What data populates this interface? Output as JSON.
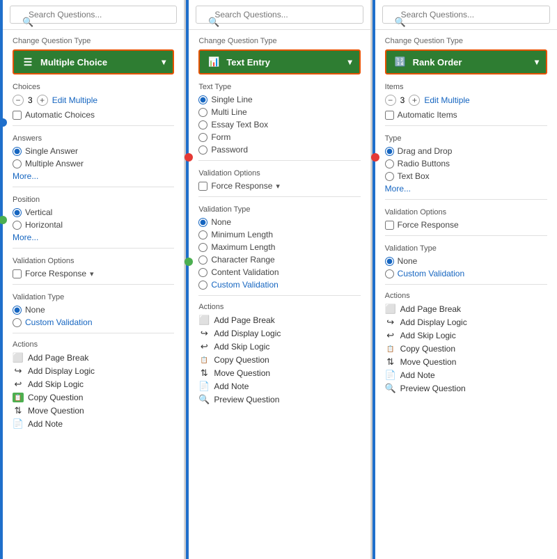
{
  "panels": [
    {
      "id": "multiple-choice",
      "search": {
        "placeholder": "Search Questions...",
        "value": ""
      },
      "changeQuestionTypeLabel": "Change Question Type",
      "questionType": {
        "label": "Multiple Choice",
        "icon": "list-icon"
      },
      "choices": {
        "label": "Choices",
        "count": "3",
        "editMultipleLabel": "Edit Multiple",
        "automaticChoicesLabel": "Automatic Choices"
      },
      "answers": {
        "label": "Answers",
        "options": [
          "Single Answer",
          "Multiple Answer"
        ],
        "selected": 0,
        "moreLabel": "More..."
      },
      "position": {
        "label": "Position",
        "options": [
          "Vertical",
          "Horizontal"
        ],
        "selected": 0,
        "moreLabel": "More..."
      },
      "validationOptions": {
        "label": "Validation Options",
        "forceResponseLabel": "Force Response"
      },
      "validationType": {
        "label": "Validation Type",
        "options": [
          "None",
          "Custom Validation"
        ],
        "selected": 0
      },
      "actions": {
        "label": "Actions",
        "items": [
          {
            "label": "Add Page Break",
            "icon": "page-break-icon"
          },
          {
            "label": "Add Display Logic",
            "icon": "display-logic-icon"
          },
          {
            "label": "Add Skip Logic",
            "icon": "skip-logic-icon"
          },
          {
            "label": "Copy Question",
            "icon": "copy-question-icon"
          },
          {
            "label": "Move Question",
            "icon": "move-question-icon"
          },
          {
            "label": "Add Note",
            "icon": "add-note-icon"
          }
        ]
      }
    },
    {
      "id": "text-entry",
      "search": {
        "placeholder": "Search Questions...",
        "value": ""
      },
      "changeQuestionTypeLabel": "Change Question Type",
      "questionType": {
        "label": "Text Entry",
        "icon": "text-entry-icon"
      },
      "textType": {
        "label": "Text Type",
        "options": [
          "Single Line",
          "Multi Line",
          "Essay Text Box",
          "Form",
          "Password"
        ],
        "selected": 0
      },
      "validationOptions": {
        "label": "Validation Options",
        "forceResponseLabel": "Force Response"
      },
      "validationType": {
        "label": "Validation Type",
        "options": [
          "None",
          "Minimum Length",
          "Maximum Length",
          "Character Range",
          "Content Validation",
          "Custom Validation"
        ],
        "selected": 0
      },
      "actions": {
        "label": "Actions",
        "items": [
          {
            "label": "Add Page Break",
            "icon": "page-break-icon"
          },
          {
            "label": "Add Display Logic",
            "icon": "display-logic-icon"
          },
          {
            "label": "Add Skip Logic",
            "icon": "skip-logic-icon"
          },
          {
            "label": "Copy Question",
            "icon": "copy-question-icon"
          },
          {
            "label": "Move Question",
            "icon": "move-question-icon"
          },
          {
            "label": "Add Note",
            "icon": "add-note-icon"
          },
          {
            "label": "Preview Question",
            "icon": "preview-icon"
          }
        ]
      }
    },
    {
      "id": "rank-order",
      "search": {
        "placeholder": "Search Questions...",
        "value": ""
      },
      "changeQuestionTypeLabel": "Change Question Type",
      "questionType": {
        "label": "Rank Order",
        "icon": "rank-order-icon"
      },
      "items": {
        "label": "Items",
        "count": "3",
        "editMultipleLabel": "Edit Multiple",
        "automaticItemsLabel": "Automatic Items"
      },
      "type": {
        "label": "Type",
        "options": [
          "Drag and Drop",
          "Radio Buttons",
          "Text Box"
        ],
        "selected": 0,
        "moreLabel": "More..."
      },
      "validationOptions": {
        "label": "Validation Options",
        "forceResponseLabel": "Force Response"
      },
      "validationType": {
        "label": "Validation Type",
        "options": [
          "None",
          "Custom Validation"
        ],
        "selected": 0
      },
      "actions": {
        "label": "Actions",
        "items": [
          {
            "label": "Add Page Break",
            "icon": "page-break-icon"
          },
          {
            "label": "Add Display Logic",
            "icon": "display-logic-icon"
          },
          {
            "label": "Add Skip Logic",
            "icon": "skip-logic-icon"
          },
          {
            "label": "Copy Question",
            "icon": "copy-question-icon"
          },
          {
            "label": "Move Question",
            "icon": "move-question-icon"
          },
          {
            "label": "Add Note",
            "icon": "add-note-icon"
          },
          {
            "label": "Preview Question",
            "icon": "preview-icon"
          }
        ]
      }
    }
  ]
}
